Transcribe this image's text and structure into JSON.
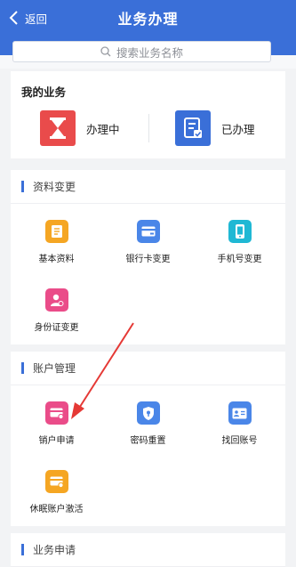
{
  "navbar": {
    "back_label": "返回",
    "title": "业务办理"
  },
  "search": {
    "placeholder": "搜索业务名称"
  },
  "my_business": {
    "title": "我的业务",
    "items": [
      {
        "label": "办理中",
        "icon": "hourglass-icon",
        "color": "#e94b4b"
      },
      {
        "label": "已办理",
        "icon": "checklist-icon",
        "color": "#3a6fd8"
      }
    ]
  },
  "sections": [
    {
      "title": "资料变更",
      "items": [
        {
          "label": "基本资料",
          "icon": "document-icon",
          "color": "#f5a623"
        },
        {
          "label": "银行卡变更",
          "icon": "bank-card-icon",
          "color": "#4a86e8"
        },
        {
          "label": "手机号变更",
          "icon": "mobile-phone-icon",
          "color": "#1fb8d4"
        },
        {
          "label": "身份证变更",
          "icon": "id-person-icon",
          "color": "#ea4c89"
        }
      ]
    },
    {
      "title": "账户管理",
      "items": [
        {
          "label": "销户申请",
          "icon": "card-close-icon",
          "color": "#ea4c89"
        },
        {
          "label": "密码重置",
          "icon": "shield-key-icon",
          "color": "#4a86e8"
        },
        {
          "label": "找回账号",
          "icon": "id-card-icon",
          "color": "#4a86e8"
        },
        {
          "label": "休眠账户激活",
          "icon": "wallet-card-icon",
          "color": "#f5a623"
        }
      ]
    },
    {
      "title": "业务申请",
      "items": []
    }
  ],
  "annotation": {
    "arrow_color": "#e53935"
  }
}
